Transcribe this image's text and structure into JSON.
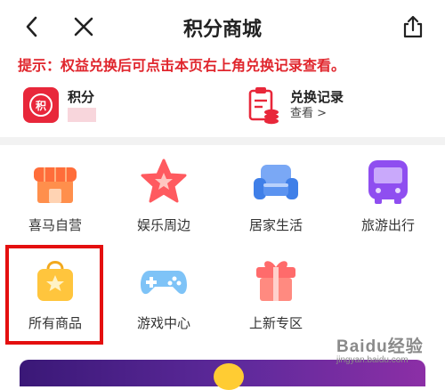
{
  "header": {
    "title": "积分商城",
    "back_icon": "chevron-left-icon",
    "close_icon": "close-icon",
    "share_icon": "share-icon"
  },
  "tip": {
    "text": "提示：权益兑换后可点击本页右上角兑换记录查看。",
    "color": "#e0262d"
  },
  "summary": {
    "points": {
      "label": "积分",
      "badge_text": "积",
      "icon": "points-badge-icon"
    },
    "records": {
      "label": "兑换记录",
      "link": "查看 >",
      "icon": "clipboard-coins-icon"
    }
  },
  "categories": [
    {
      "label": "喜马自营",
      "icon": "storefront-icon"
    },
    {
      "label": "娱乐周边",
      "icon": "star-icon"
    },
    {
      "label": "居家生活",
      "icon": "sofa-icon"
    },
    {
      "label": "旅游出行",
      "icon": "bus-icon"
    },
    {
      "label": "所有商品",
      "icon": "shopping-bag-icon"
    },
    {
      "label": "游戏中心",
      "icon": "gamepad-icon"
    },
    {
      "label": "上新专区",
      "icon": "gift-box-icon"
    }
  ],
  "highlight_color": "#e40f0f",
  "watermark": {
    "logo": "Baidu经验",
    "url": "jingyan.baidu.com"
  }
}
